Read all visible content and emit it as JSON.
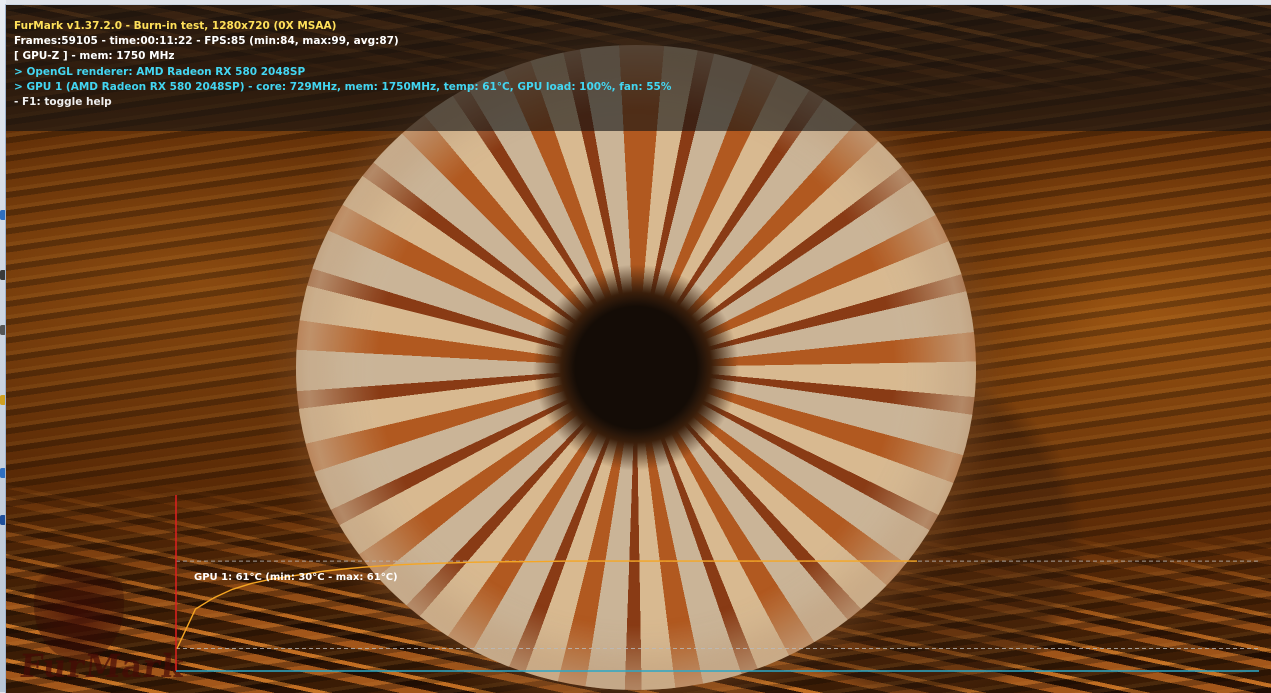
{
  "app": {
    "title_line": "FurMark v1.37.2.0 - Burn-in test, 1280x720 (0X MSAA)",
    "stats_line": "Frames:59105 - time:00:11:22 - FPS:85 (min:84, max:99, avg:87)",
    "gpuz_line": "[ GPU-Z ] - mem: 1750 MHz",
    "renderer_line": "> OpenGL renderer: AMD Radeon RX 580 2048SP",
    "gpu_line": "> GPU 1 (AMD Radeon RX 580 2048SP) - core: 729MHz, mem: 1750MHz, temp: 61°C, GPU load: 100%, fan: 55%",
    "help_line": "- F1: toggle help"
  },
  "logo": {
    "text": "FurMark",
    "icon": "furmark-logo-icon"
  },
  "chart_data": {
    "type": "line",
    "title": "GPU 1: 61°C (min: 30°C - max: 61°C)",
    "series": [
      {
        "name": "GPU 1",
        "color": "#f5a623",
        "values": [
          30,
          44,
          48,
          51,
          53,
          54.5,
          55.5,
          56.5,
          57.5,
          58.2,
          58.8,
          59.3,
          59.7,
          60,
          60.2,
          60.4,
          60.6,
          60.7,
          60.8,
          60.8,
          60.9,
          61,
          61,
          61,
          61,
          61,
          61,
          61,
          61,
          61,
          61,
          61,
          61,
          61,
          61,
          61,
          61,
          61,
          61,
          61,
          61
        ]
      }
    ],
    "reference_lines": [
      61,
      30
    ],
    "ylim": [
      22,
      66
    ],
    "colors": {
      "axis_y": "#e02020",
      "axis_x": "#2aa8c8",
      "reference": "#bbbbbb"
    }
  }
}
